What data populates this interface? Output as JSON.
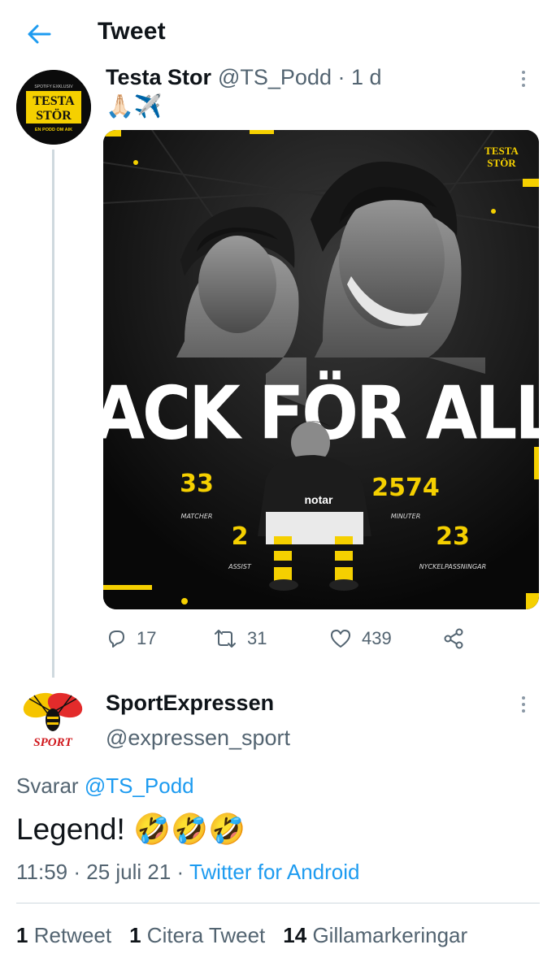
{
  "header": {
    "title": "Tweet",
    "back_icon": "arrow-left-icon"
  },
  "colors": {
    "link": "#1d9bf0",
    "secondary_text": "#536471",
    "brand_yellow": "#f5d000"
  },
  "tweet1": {
    "author_name": "Testa Stor",
    "handle_time": "@TS_Podd · 1 d",
    "emoji": "🙏🏻✈️",
    "avatar": {
      "line1": "TESTA",
      "line2": "STÖR",
      "tagline": "EN PODD OM AIK",
      "top_text": "SPOTIFY EXKLUSIV"
    },
    "media": {
      "logo_line1": "TESTA",
      "logo_line2": "STÖR",
      "headline": "TACK FÖR ALLT",
      "sponsor": "notar",
      "stats": [
        {
          "value": "33",
          "label": "MATCHER"
        },
        {
          "value": "2574",
          "label": "MINUTER"
        },
        {
          "value": "2",
          "label": "ASSIST"
        },
        {
          "value": "23",
          "label": "NYCKELPASSNINGAR"
        }
      ]
    },
    "actions": {
      "replies": "17",
      "retweets": "31",
      "likes": "439"
    }
  },
  "tweet2": {
    "author_name": "SportExpressen",
    "handle": "@expressen_sport",
    "avatar_text": "SPORT",
    "replying_prefix": "Svarar",
    "replying_to": "@TS_Podd",
    "text": "Legend! 🤣🤣🤣",
    "time": "11:59 · 25 juli 21 · ",
    "client": "Twitter for Android",
    "stats": {
      "retweets_count": "1",
      "retweets_label": "Retweet",
      "quotes_count": "1",
      "quotes_label": "Citera Tweet",
      "likes_count": "14",
      "likes_label": "Gillamarkeringar"
    }
  }
}
